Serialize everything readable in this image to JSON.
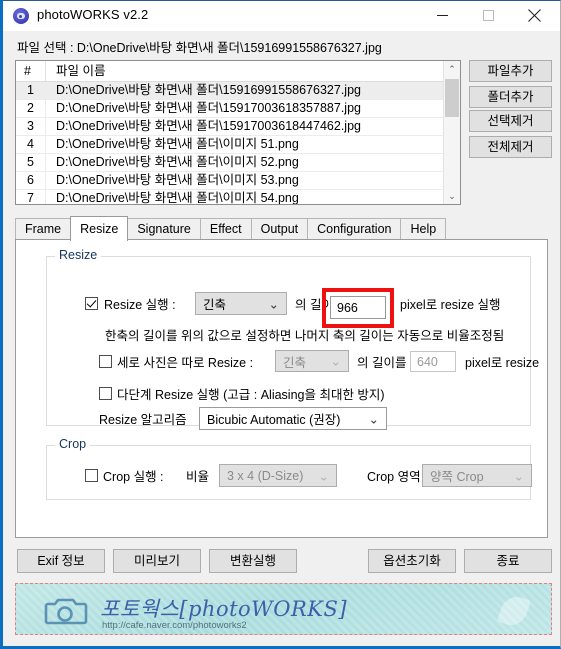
{
  "window": {
    "title": "photoWORKS v2.2",
    "icon": "camera-circle-icon",
    "minimize_label": "—",
    "maximize_label": "□",
    "close_label": "✕",
    "accent_color": "#0a6fc2"
  },
  "path": {
    "label": "파일 선택 : D:\\OneDrive\\바탕 화면\\새 폴더\\1591699155867 6327.jpg",
    "label_display": "파일 선택 : D:\\OneDrive\\바탕 화면\\새 폴더\\15916991558676327.jpg"
  },
  "filelist": {
    "columns": [
      "#",
      "파일 이름"
    ],
    "rows": [
      {
        "num": "1",
        "name": "D:\\OneDrive\\바탕 화면\\새 폴더\\15916991558676327.jpg",
        "selected": true
      },
      {
        "num": "2",
        "name": "D:\\OneDrive\\바탕 화면\\새 폴더\\15917003618357887.jpg",
        "selected": false
      },
      {
        "num": "3",
        "name": "D:\\OneDrive\\바탕 화면\\새 폴더\\15917003618447462.jpg",
        "selected": false
      },
      {
        "num": "4",
        "name": "D:\\OneDrive\\바탕 화면\\새 폴더\\이미지 51.png",
        "selected": false
      },
      {
        "num": "5",
        "name": "D:\\OneDrive\\바탕 화면\\새 폴더\\이미지 52.png",
        "selected": false
      },
      {
        "num": "6",
        "name": "D:\\OneDrive\\바탕 화면\\새 폴더\\이미지 53.png",
        "selected": false
      },
      {
        "num": "7",
        "name": "D:\\OneDrive\\바탕 화면\\새 폴더\\이미지 54.png",
        "selected": false
      }
    ],
    "scrollbar_up": "⌃",
    "scrollbar_down": "⌄"
  },
  "side_buttons": [
    {
      "label": "파일추가"
    },
    {
      "label": "폴더추가"
    },
    {
      "label": "선택제거"
    },
    {
      "label": "전체제거"
    }
  ],
  "tabs": [
    {
      "label": "Frame",
      "active": false
    },
    {
      "label": "Resize",
      "active": true
    },
    {
      "label": "Signature",
      "active": false
    },
    {
      "label": "Effect",
      "active": false
    },
    {
      "label": "Output",
      "active": false
    },
    {
      "label": "Configuration",
      "active": false
    },
    {
      "label": "Help",
      "active": false
    }
  ],
  "resize_group": {
    "title": "Resize",
    "row1": {
      "checkbox_checked": true,
      "label": "Resize 실행 :",
      "axis_value": "긴축",
      "mid_label": "의 길이를",
      "pixel_value": "966",
      "suffix_label": "pixel로 resize 실행",
      "highlight_color": "#ee1111"
    },
    "hint": "한축의 길이를 위의 값으로 설정하면 나머지 축의 길이는 자동으로 비율조정됨",
    "row2": {
      "checkbox_checked": false,
      "label": "세로 사진은 따로 Resize :",
      "axis_value": "긴축",
      "mid_label": "의 길이를",
      "pixel_value": "640",
      "suffix_label": "pixel로 resize",
      "disabled": true
    },
    "row3": {
      "checkbox_checked": false,
      "label": "다단계 Resize 실행 (고급 : Aliasing을 최대한 방지)"
    },
    "row4": {
      "label": "Resize 알고리즘",
      "algorithm_value": "Bicubic Automatic (권장)"
    }
  },
  "crop_group": {
    "title": "Crop",
    "checkbox_checked": false,
    "label": "Crop 실행 :",
    "ratio_label": "비율",
    "ratio_value": "3 x 4 (D-Size)",
    "area_label": "Crop 영역",
    "area_value": "양쪽 Crop",
    "disabled": true
  },
  "bottom_buttons": [
    {
      "label": "Exif 정보"
    },
    {
      "label": "미리보기"
    },
    {
      "label": "변환실행"
    },
    {
      "label": "옵션초기화"
    },
    {
      "label": "종료"
    }
  ],
  "banner": {
    "title": "포토웍스[photoWORKS]",
    "url": "http://cafe.naver.com/photoworks2",
    "icon": "camera-icon"
  }
}
